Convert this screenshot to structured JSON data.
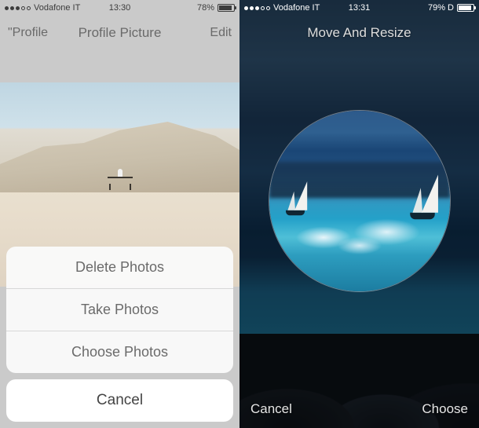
{
  "left_screen": {
    "status": {
      "carrier": "Vodafone IT",
      "time": "13:30",
      "battery_pct": "78%",
      "signal_filled": 3
    },
    "nav": {
      "back": "\"Profile",
      "title": "Profile Picture",
      "action": "Edit"
    },
    "action_sheet": {
      "items": [
        "Delete Photos",
        "Take Photos",
        "Choose Photos"
      ],
      "cancel": "Cancel"
    }
  },
  "right_screen": {
    "status": {
      "carrier": "Vodafone IT",
      "time": "13:31",
      "battery_pct": "79% D",
      "signal_filled": 3
    },
    "crop_title": "Move And Resize",
    "bottom": {
      "cancel": "Cancel",
      "choose": "Choose"
    }
  }
}
